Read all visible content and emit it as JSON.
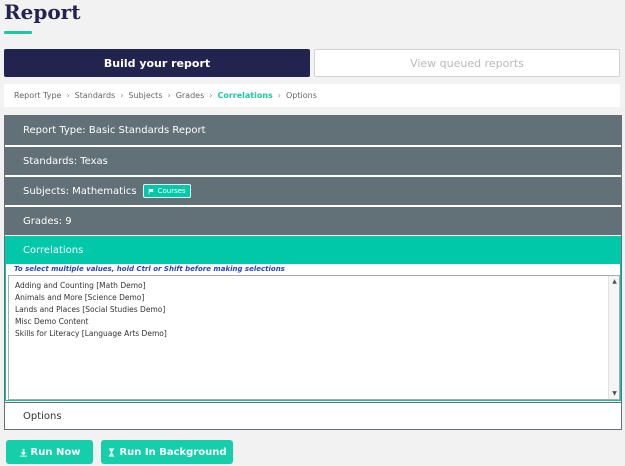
{
  "page": {
    "title": "Report"
  },
  "tabs": [
    {
      "label": "Build your report",
      "active": true
    },
    {
      "label": "View queued reports",
      "active": false
    }
  ],
  "breadcrumb": [
    {
      "label": "Report Type",
      "active": false
    },
    {
      "label": "Standards",
      "active": false
    },
    {
      "label": "Subjects",
      "active": false
    },
    {
      "label": "Grades",
      "active": false
    },
    {
      "label": "Correlations",
      "active": true
    },
    {
      "label": "Options",
      "active": false
    }
  ],
  "breadcrumb_separator": "›",
  "sections": {
    "report_type": "Report Type: Basic Standards Report",
    "standards": "Standards: Texas",
    "subjects": "Subjects: Mathematics",
    "courses_badge": "Courses",
    "grades": "Grades: 9",
    "correlations": "Correlations",
    "options": "Options"
  },
  "correlations": {
    "hint": "To select multiple values, hold Ctrl or Shift before making selections",
    "items": [
      "Adding and Counting [Math Demo]",
      "Animals and More [Science Demo]",
      "Lands and Places [Social Studies Demo]",
      "Misc Demo Content",
      "Skills for Literacy [Language Arts Demo]"
    ]
  },
  "actions": {
    "run_now": "Run Now",
    "run_background": "Run In Background"
  },
  "colors": {
    "navy": "#22234f",
    "accent": "#00c8a8",
    "section": "#627078"
  },
  "icons": {
    "courses": "flag-icon",
    "run_now": "download-icon",
    "run_background": "hourglass-icon"
  }
}
